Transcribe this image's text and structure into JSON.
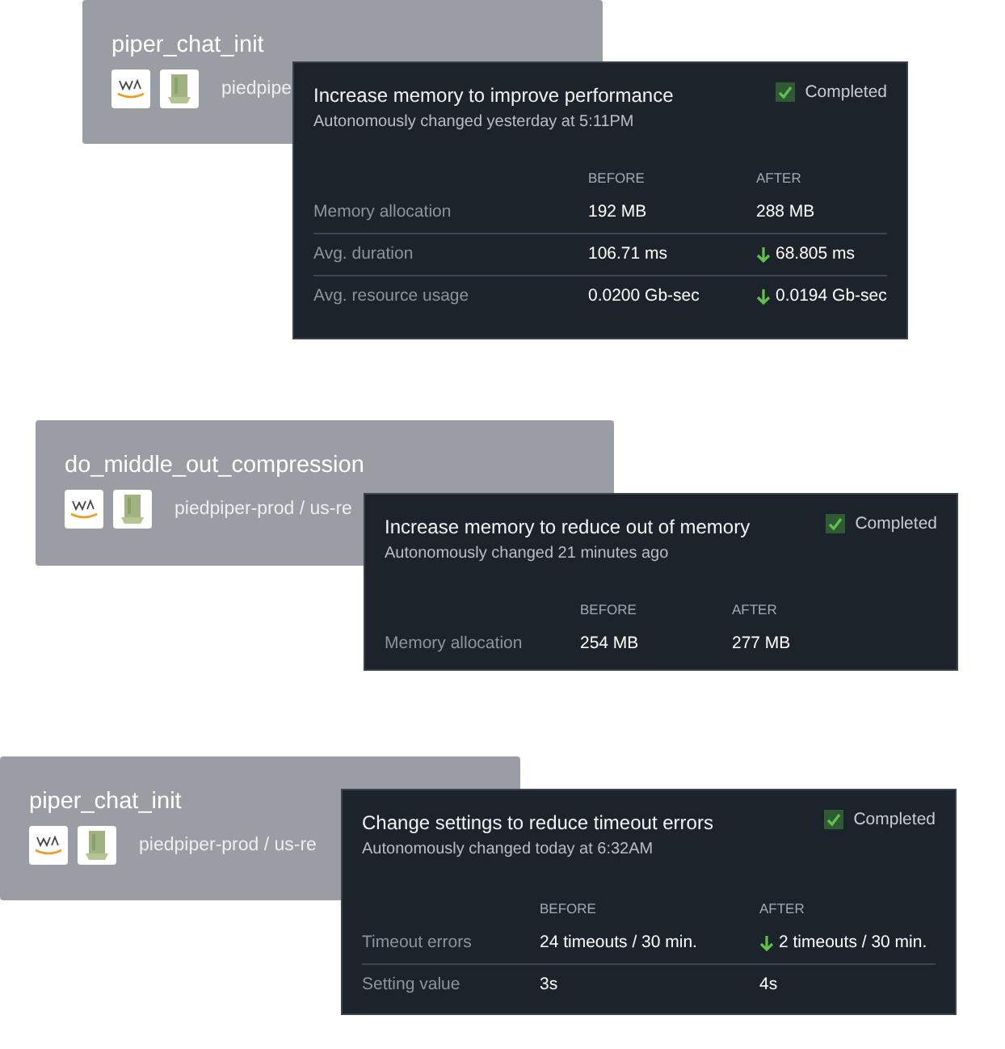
{
  "items": [
    {
      "function": "piper_chat_init",
      "location": "piedpipe",
      "change": {
        "title": "Increase memory to improve performance",
        "subtitle": "Autonomously changed yesterday at 5:11PM",
        "status": {
          "label": "Completed",
          "checked": true
        },
        "columns": [
          "BEFORE",
          "AFTER"
        ],
        "rows": [
          {
            "label": "Memory allocation",
            "before": "192 MB",
            "after": "288 MB",
            "improved": false
          },
          {
            "label": "Avg. duration",
            "before": "106.71 ms",
            "after": "68.805 ms",
            "improved": true
          },
          {
            "label": "Avg. resource usage",
            "before": "0.0200 Gb-sec",
            "after": "0.0194 Gb-sec",
            "improved": true
          }
        ]
      }
    },
    {
      "function": "do_middle_out_compression",
      "location": "piedpiper-prod / us-re",
      "change": {
        "title": "Increase memory to reduce out of memory",
        "subtitle": "Autonomously changed 21 minutes ago",
        "status": {
          "label": "Completed",
          "checked": true
        },
        "columns": [
          "BEFORE",
          "AFTER"
        ],
        "rows": [
          {
            "label": "Memory allocation",
            "before": "254 MB",
            "after": "277 MB",
            "improved": false
          }
        ]
      }
    },
    {
      "function": "piper_chat_init",
      "location": "piedpiper-prod / us-re",
      "change": {
        "title": "Change settings to reduce timeout errors",
        "subtitle": "Autonomously changed today at 6:32AM",
        "status": {
          "label": "Completed",
          "checked": true
        },
        "columns": [
          "BEFORE",
          "AFTER"
        ],
        "rows": [
          {
            "label": "Timeout errors",
            "before": "24 timeouts / 30 min.",
            "after": "2 timeouts / 30 min.",
            "improved": true
          },
          {
            "label": "Setting value",
            "before": "3s",
            "after": "4s",
            "improved": false
          }
        ]
      }
    }
  ]
}
